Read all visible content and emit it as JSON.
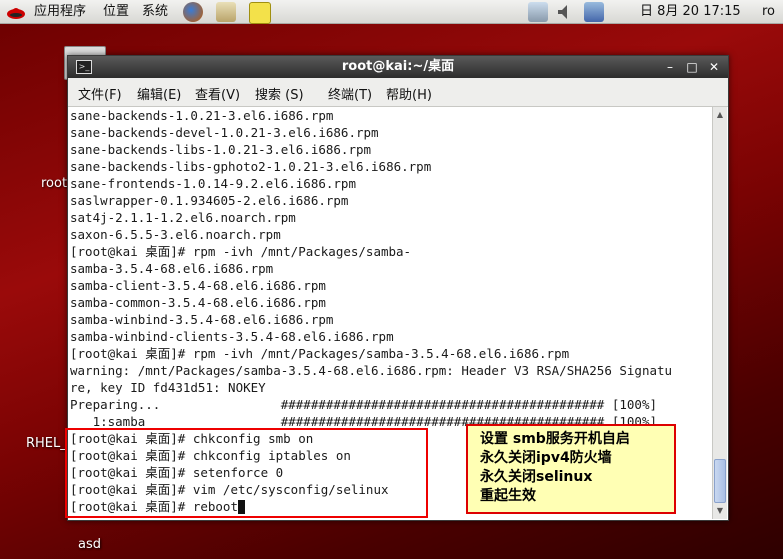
{
  "top_panel": {
    "menu": [
      "应用程序",
      "位置",
      "系统"
    ],
    "clock": "日 8月 20 17:15"
  },
  "desktop": {
    "icons": [
      {
        "label": "root"
      },
      {
        "label": "RHEL_"
      },
      {
        "label": "asd"
      }
    ]
  },
  "window": {
    "title": "root@kai:~/桌面",
    "controls": [
      "–",
      "□",
      "✕"
    ],
    "menu": [
      "文件(F)",
      "编辑(E)",
      "查看(V)",
      "搜索 (S)",
      "终端(T)",
      "帮助(H)"
    ]
  },
  "terminal": {
    "lines": [
      "sane-backends-1.0.21-3.el6.i686.rpm",
      "sane-backends-devel-1.0.21-3.el6.i686.rpm",
      "sane-backends-libs-1.0.21-3.el6.i686.rpm",
      "sane-backends-libs-gphoto2-1.0.21-3.el6.i686.rpm",
      "sane-frontends-1.0.14-9.2.el6.i686.rpm",
      "saslwrapper-0.1.934605-2.el6.i686.rpm",
      "sat4j-2.1.1-1.2.el6.noarch.rpm",
      "saxon-6.5.5-3.el6.noarch.rpm",
      "[root@kai 桌面]# rpm -ivh /mnt/Packages/samba-",
      "samba-3.5.4-68.el6.i686.rpm",
      "samba-client-3.5.4-68.el6.i686.rpm",
      "samba-common-3.5.4-68.el6.i686.rpm",
      "samba-winbind-3.5.4-68.el6.i686.rpm",
      "samba-winbind-clients-3.5.4-68.el6.i686.rpm",
      "[root@kai 桌面]# rpm -ivh /mnt/Packages/samba-3.5.4-68.el6.i686.rpm",
      "warning: /mnt/Packages/samba-3.5.4-68.el6.i686.rpm: Header V3 RSA/SHA256 Signatu",
      "re, key ID fd431d51: NOKEY",
      "Preparing...                ########################################### [100%]",
      "   1:samba                  ########################################### [100%]",
      "[root@kai 桌面]# chkconfig smb on",
      "[root@kai 桌面]# chkconfig iptables on",
      "[root@kai 桌面]# setenforce 0",
      "[root@kai 桌面]# vim /etc/sysconfig/selinux",
      "[root@kai 桌面]# reboot"
    ]
  },
  "annotation": {
    "lines": [
      "设置 smb服务开机自启",
      "永久关闭ipv4防火墙",
      "永久关闭selinux",
      "重起生效"
    ]
  }
}
